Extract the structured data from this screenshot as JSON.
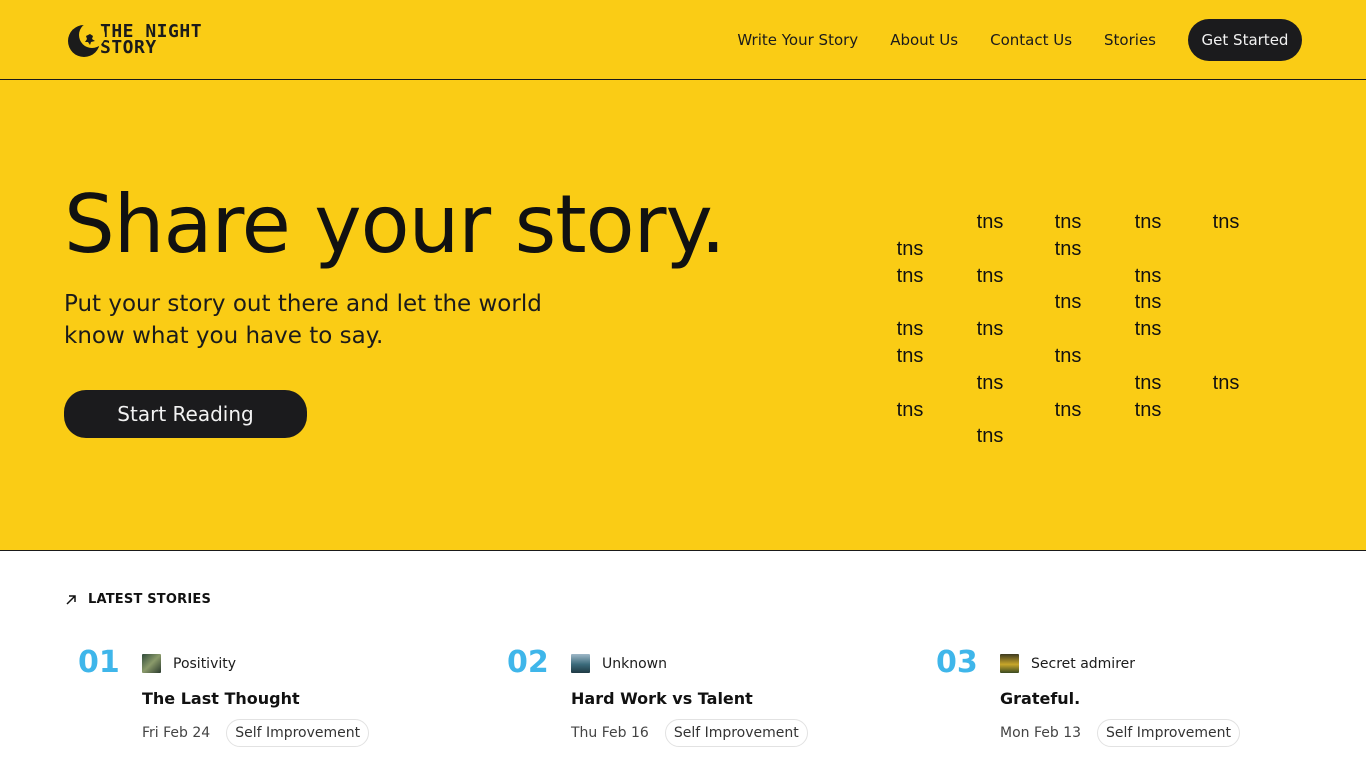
{
  "brand": {
    "line1": "THE NIGHT",
    "line2": "STORY",
    "icon": "crescent-moon-icon"
  },
  "nav": {
    "links": [
      "Write Your Story",
      "About Us",
      "Contact Us",
      "Stories"
    ],
    "cta": "Get Started"
  },
  "hero": {
    "title": "Share your story.",
    "subtitle": "Put your story out there and let the world know what you have to say.",
    "button": "Start Reading",
    "tns_label": "tns"
  },
  "latest": {
    "label": "LATEST STORIES",
    "icon": "arrow-up-right-icon",
    "stories": [
      {
        "number": "01",
        "author": "Positivity",
        "title": "The Last Thought",
        "date": "Fri Feb 24",
        "tag": "Self Improvement"
      },
      {
        "number": "02",
        "author": "Unknown",
        "title": "Hard Work vs Talent",
        "date": "Thu Feb 16",
        "tag": "Self Improvement"
      },
      {
        "number": "03",
        "author": "Secret admirer",
        "title": "Grateful.",
        "date": "Mon Feb 13",
        "tag": "Self Improvement"
      }
    ]
  },
  "colors": {
    "accent": "#facc15",
    "dark": "#1b1b1d",
    "number": "#3fb6ea"
  }
}
